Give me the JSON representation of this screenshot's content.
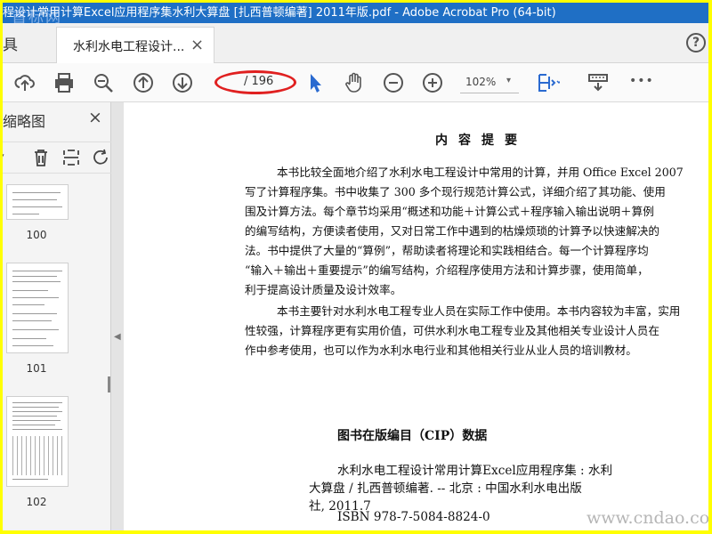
{
  "window": {
    "title": "程设计常用计算Excel应用程序集水利大算盘 [扎西普顿编著] 2011年版.pdf - Adobe Acrobat Pro (64-bit)",
    "watermark_top": "首标网",
    "accent": "#1f6fc5",
    "frame_color": "#ffff00"
  },
  "tabs": {
    "tools_label": "具",
    "doc_label": "水利水电工程设计...",
    "close_glyph": "×",
    "help_glyph": "?"
  },
  "toolbar": {
    "page_input": "/ 196",
    "zoom": "102%",
    "zoom_caret": "▾",
    "more": "•••",
    "highlight_color": "#e02020"
  },
  "left_panel": {
    "title": "缩略图",
    "close_glyph": "×",
    "thumbnails": [
      {
        "label": "100"
      },
      {
        "label": "101"
      },
      {
        "label": "102"
      }
    ]
  },
  "document": {
    "heading": "内容提要",
    "paragraphs": [
      "本书比较全面地介绍了水利水电工程设计中常用的计算，并用 Office Excel 2007",
      "写了计算程序集。书中收集了 300 多个现行规范计算公式，详细介绍了其功能、使用",
      "围及计算方法。每个章节均采用“概述和功能＋计算公式＋程序输入输出说明＋算例",
      "的编写结构，方便读者使用，又对日常工作中遇到的枯燥烦琐的计算予以快速解决的",
      "法。书中提供了大量的“算例”，帮助读者将理论和实践相结合。每一个计算程序均",
      "“输入＋输出＋重要提示”的编写结构，介绍程序使用方法和计算步骤，使用简单，",
      "利于提高设计质量及设计效率。",
      "本书主要针对水利水电工程专业人员在实际工作中使用。本书内容较为丰富，实用",
      "性较强，计算程序更有实用价值，可供水利水电工程专业及其他相关专业设计人员在",
      "作中参考使用，也可以作为水利水电行业和其他相关行业从业人员的培训教材。"
    ],
    "cip_heading": "图书在版编目（CIP）数据",
    "cip_lines": [
      "水利水电工程设计常用计算Excel应用程序集 : 水利",
      "大算盘 / 扎西普顿编著. -- 北京 : 中国水利水电出版",
      "社, 2011.7",
      "ISBN 978-7-5084-8824-0"
    ],
    "watermark": "www.cndao.com"
  }
}
